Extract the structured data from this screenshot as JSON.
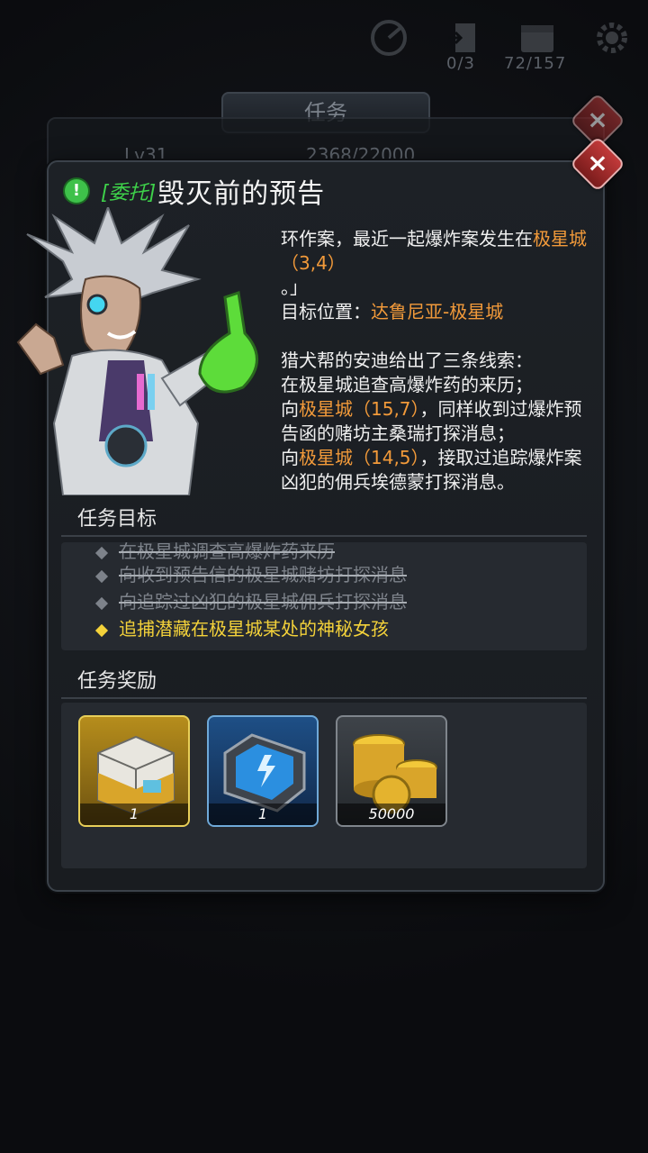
{
  "hud": {
    "battle_count": "0/3",
    "energy_count": "72/157",
    "icons": [
      "radar-icon",
      "door-icon",
      "calendar-icon",
      "gear-icon"
    ]
  },
  "background_panel": {
    "title": "任务",
    "level": "Lv31",
    "exp": "2368/22000"
  },
  "mission": {
    "tag": "[委托]",
    "title": "毁灭前的预告",
    "story": {
      "line1_a": "环作案，最近一起爆炸案发生在",
      "line1_b": "极星城（3,4）",
      "line2": "。」",
      "target_label": "目标位置：",
      "target_value": "达鲁尼亚-极星城",
      "clue_intro": "猎犬帮的安迪给出了三条线索：",
      "clue1": "在极星城追查高爆炸药的来历；",
      "clue2_a": "向",
      "clue2_b": "极星城（15,7）",
      "clue2_c": "，同样收到过爆炸预告函的赌坊主桑瑞打探消息；",
      "clue3_a": "向",
      "clue3_b": "极星城（14,5）",
      "clue3_c": "，接取过追踪爆炸案凶犯的佣兵埃德蒙打探消息。"
    },
    "objectives_header": "任务目标",
    "objectives": [
      {
        "text": "在极星城调查高爆炸药来历",
        "status": "done"
      },
      {
        "text": "向收到预告信的极星城赌坊打探消息",
        "status": "done"
      },
      {
        "text": "向追踪过凶犯的极星城佣兵打探消息",
        "status": "done"
      },
      {
        "text": "追捕潜藏在极星城某处的神秘女孩",
        "status": "active"
      }
    ],
    "rewards_header": "任务奖励",
    "rewards": [
      {
        "icon": "supply-crate-icon",
        "count": "1"
      },
      {
        "icon": "energy-cell-icon",
        "count": "1"
      },
      {
        "icon": "gold-coins-icon",
        "count": "50000"
      }
    ]
  },
  "colors": {
    "accent_green": "#3ed24a",
    "accent_orange": "#f29a3a",
    "accent_yellow": "#f4d23a",
    "close_red": "#c23a3a"
  }
}
